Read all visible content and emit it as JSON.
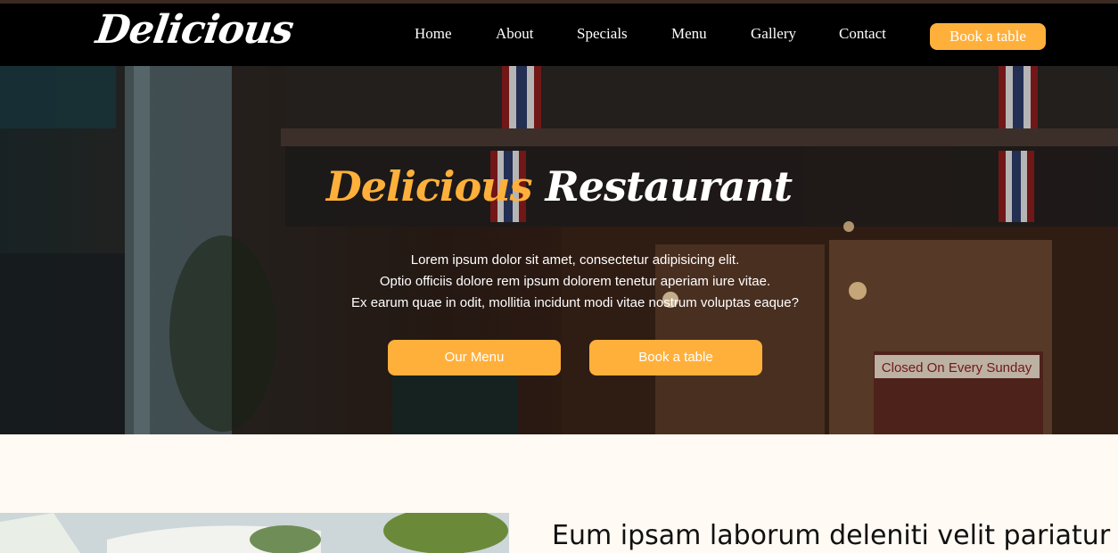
{
  "brand": {
    "logo_text": "Delicious"
  },
  "nav": {
    "links": [
      "Home",
      "About",
      "Specials",
      "Menu",
      "Gallery",
      "Contact"
    ],
    "cta_label": "Book a table"
  },
  "hero": {
    "title_accent": "Delicious",
    "title_rest": "Restaurant",
    "lines": [
      "Lorem ipsum dolor sit amet, consectetur adipisicing elit.",
      "Optio officiis dolore rem ipsum dolorem tenetur aperiam iure vitae.",
      "Ex earum quae in odit, mollitia incidunt modi vitae nostrum voluptas eaque?"
    ],
    "buttons": {
      "menu_label": "Our Menu",
      "book_label": "Book a table"
    },
    "sign_text": "Closed On Every Sunday"
  },
  "about": {
    "heading": "Eum ipsam laborum deleniti velit pariatur"
  },
  "colors": {
    "accent": "#ffb03b",
    "navbar": "#000000",
    "page_bg": "#fffaf3"
  }
}
